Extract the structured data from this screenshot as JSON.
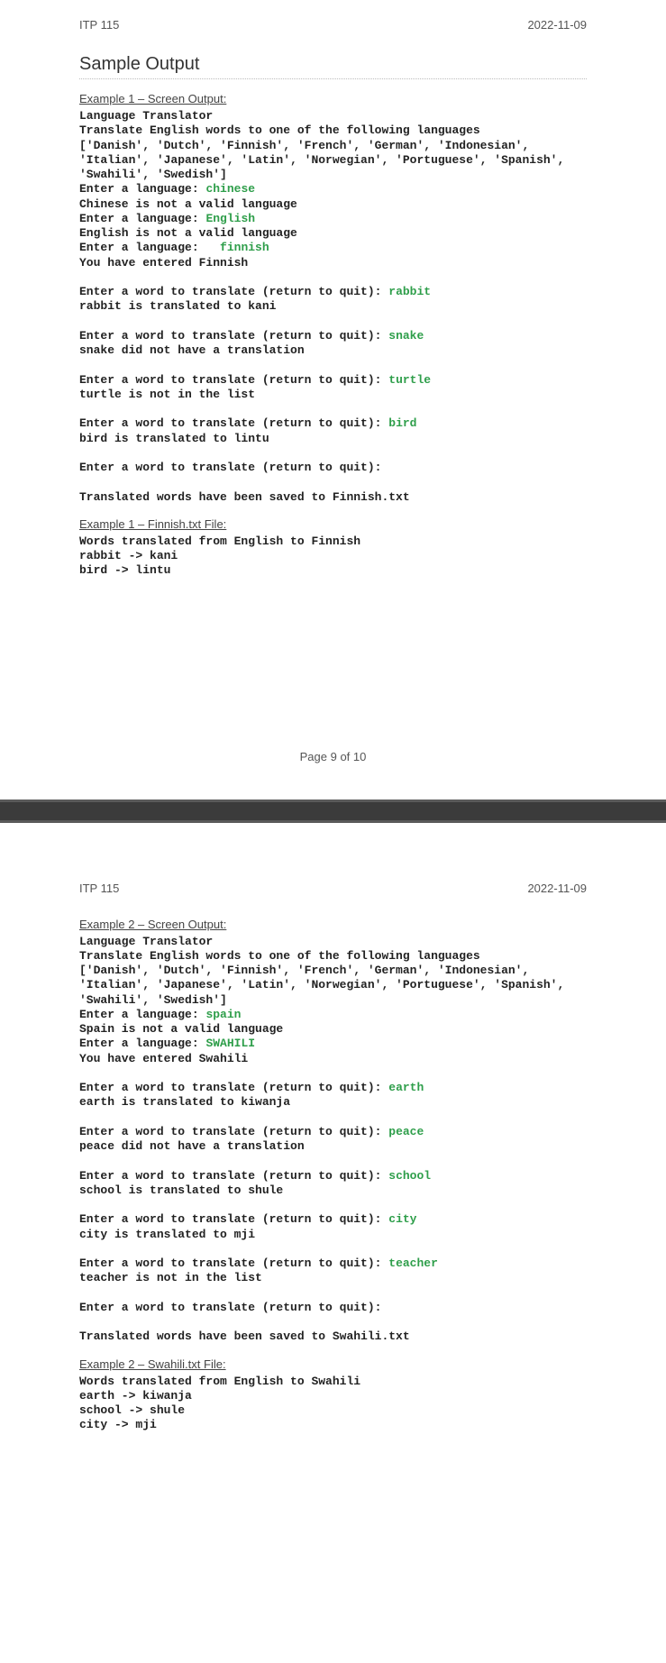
{
  "header": {
    "course": "ITP 115",
    "date": "2022-11-09"
  },
  "section_title": "Sample Output",
  "page_footer": "Page 9 of 10",
  "ex1": {
    "heading_screen": "Example 1 – Screen Output:",
    "heading_file": "Example 1 – Finnish.txt File:",
    "l01": "Language Translator",
    "l02": "Translate English words to one of the following languages",
    "l03": "['Danish', 'Dutch', 'Finnish', 'French', 'German', 'Indonesian',",
    "l04": "'Italian', 'Japanese', 'Latin', 'Norwegian', 'Portuguese', 'Spanish',",
    "l05": "'Swahili', 'Swedish']",
    "p_lang": "Enter a language: ",
    "in_lang1": "chinese",
    "r_lang1": "Chinese is not a valid language",
    "in_lang2": "English",
    "r_lang2": "English is not a valid language",
    "in_lang3": "  finnish",
    "r_lang3": "You have entered Finnish",
    "p_word": "Enter a word to translate (return to quit): ",
    "in_w1": "rabbit",
    "r_w1": "rabbit is translated to kani",
    "in_w2": "snake",
    "r_w2": "snake did not have a translation",
    "in_w3": "turtle",
    "r_w3": "turtle is not in the list",
    "in_w4": "bird",
    "r_w4": "bird is translated to lintu",
    "saved": "Translated words have been saved to Finnish.txt",
    "f1": "Words translated from English to Finnish",
    "f2": "rabbit -> kani",
    "f3": "bird -> lintu"
  },
  "ex2": {
    "heading_screen": "Example 2 – Screen Output:",
    "heading_file": "Example 2 – Swahili.txt File:",
    "l01": "Language Translator",
    "l02": "Translate English words to one of the following languages",
    "l03": "['Danish', 'Dutch', 'Finnish', 'French', 'German', 'Indonesian',",
    "l04": "'Italian', 'Japanese', 'Latin', 'Norwegian', 'Portuguese', 'Spanish',",
    "l05": "'Swahili', 'Swedish']",
    "p_lang": "Enter a language: ",
    "in_lang1": "spain",
    "r_lang1": "Spain is not a valid language",
    "in_lang2": "SWAHILI",
    "r_lang2": "You have entered Swahili",
    "p_word": "Enter a word to translate (return to quit): ",
    "in_w1": "earth",
    "r_w1": "earth is translated to kiwanja",
    "in_w2": "peace",
    "r_w2": "peace did not have a translation",
    "in_w3": "school",
    "r_w3": "school is translated to shule",
    "in_w4": "city",
    "r_w4": "city is translated to mji",
    "in_w5": "teacher",
    "r_w5": "teacher is not in the list",
    "saved": "Translated words have been saved to Swahili.txt",
    "f1": "Words translated from English to Swahili",
    "f2": "earth -> kiwanja",
    "f3": "school -> shule",
    "f4": "city -> mji"
  }
}
